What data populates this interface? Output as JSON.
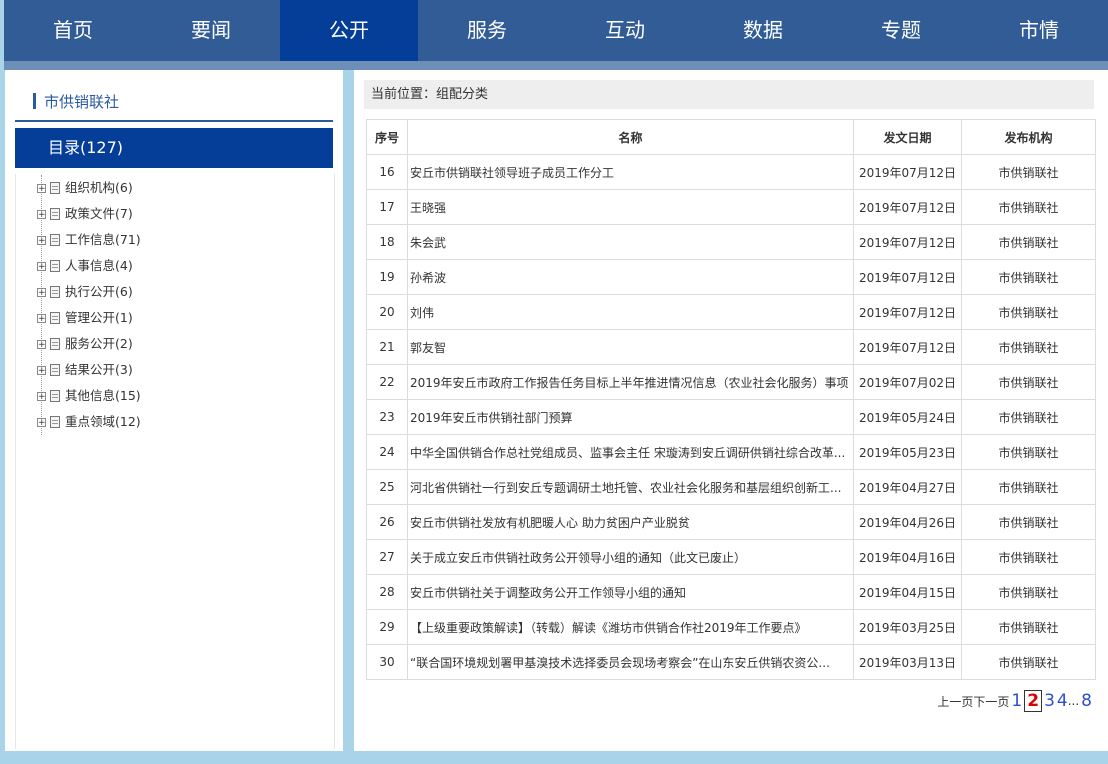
{
  "nav": [
    {
      "label": "首页"
    },
    {
      "label": "要闻"
    },
    {
      "label": "公开",
      "active": true
    },
    {
      "label": "服务"
    },
    {
      "label": "互动"
    },
    {
      "label": "数据"
    },
    {
      "label": "专题"
    },
    {
      "label": "市情"
    }
  ],
  "sidebar": {
    "title": "市供销联社",
    "directory": "目录(127)",
    "items": [
      {
        "label": "组织机构(6)"
      },
      {
        "label": "政策文件(7)"
      },
      {
        "label": "工作信息(71)"
      },
      {
        "label": "人事信息(4)"
      },
      {
        "label": "执行公开(6)"
      },
      {
        "label": "管理公开(1)"
      },
      {
        "label": "服务公开(2)"
      },
      {
        "label": "结果公开(3)"
      },
      {
        "label": "其他信息(15)"
      },
      {
        "label": "重点领域(12)"
      }
    ]
  },
  "breadcrumb": "当前位置：组配分类",
  "table": {
    "headers": {
      "num": "序号",
      "name": "名称",
      "date": "发文日期",
      "org": "发布机构"
    },
    "rows": [
      {
        "num": "16",
        "name": "安丘市供销联社领导班子成员工作分工",
        "date": "2019年07月12日",
        "org": "市供销联社"
      },
      {
        "num": "17",
        "name": "王晓强",
        "date": "2019年07月12日",
        "org": "市供销联社"
      },
      {
        "num": "18",
        "name": "朱会武",
        "date": "2019年07月12日",
        "org": "市供销联社"
      },
      {
        "num": "19",
        "name": "孙希波",
        "date": "2019年07月12日",
        "org": "市供销联社"
      },
      {
        "num": "20",
        "name": "刘伟",
        "date": "2019年07月12日",
        "org": "市供销联社"
      },
      {
        "num": "21",
        "name": "郭友智",
        "date": "2019年07月12日",
        "org": "市供销联社"
      },
      {
        "num": "22",
        "name": "2019年安丘市政府工作报告任务目标上半年推进情况信息（农业社会化服务）事项",
        "date": "2019年07月02日",
        "org": "市供销联社"
      },
      {
        "num": "23",
        "name": "2019年安丘市供销社部门预算",
        "date": "2019年05月24日",
        "org": "市供销联社"
      },
      {
        "num": "24",
        "name": "中华全国供销合作总社党组成员、监事会主任 宋璇涛到安丘调研供销社综合改革...",
        "date": "2019年05月23日",
        "org": "市供销联社"
      },
      {
        "num": "25",
        "name": "河北省供销社一行到安丘专题调研土地托管、农业社会化服务和基层组织创新工...",
        "date": "2019年04月27日",
        "org": "市供销联社"
      },
      {
        "num": "26",
        "name": "安丘市供销社发放有机肥暖人心 助力贫困户产业脱贫",
        "date": "2019年04月26日",
        "org": "市供销联社"
      },
      {
        "num": "27",
        "name": "关于成立安丘市供销社政务公开领导小组的通知（此文已废止）",
        "date": "2019年04月16日",
        "org": "市供销联社"
      },
      {
        "num": "28",
        "name": "安丘市供销社关于调整政务公开工作领导小组的通知",
        "date": "2019年04月15日",
        "org": "市供销联社"
      },
      {
        "num": "29",
        "name": "【上级重要政策解读】（转载）解读《潍坊市供销合作社2019年工作要点》",
        "date": "2019年03月25日",
        "org": "市供销联社"
      },
      {
        "num": "30",
        "name": "“联合国环境规划署甲基溴技术选择委员会现场考察会”在山东安丘供销农资公...",
        "date": "2019年03月13日",
        "org": "市供销联社"
      }
    ]
  },
  "pager": {
    "prev": "上一页",
    "next": "下一页",
    "pages": [
      "1",
      "2",
      "3",
      "4"
    ],
    "current": "2",
    "ellipsis": "...",
    "last": "8"
  }
}
